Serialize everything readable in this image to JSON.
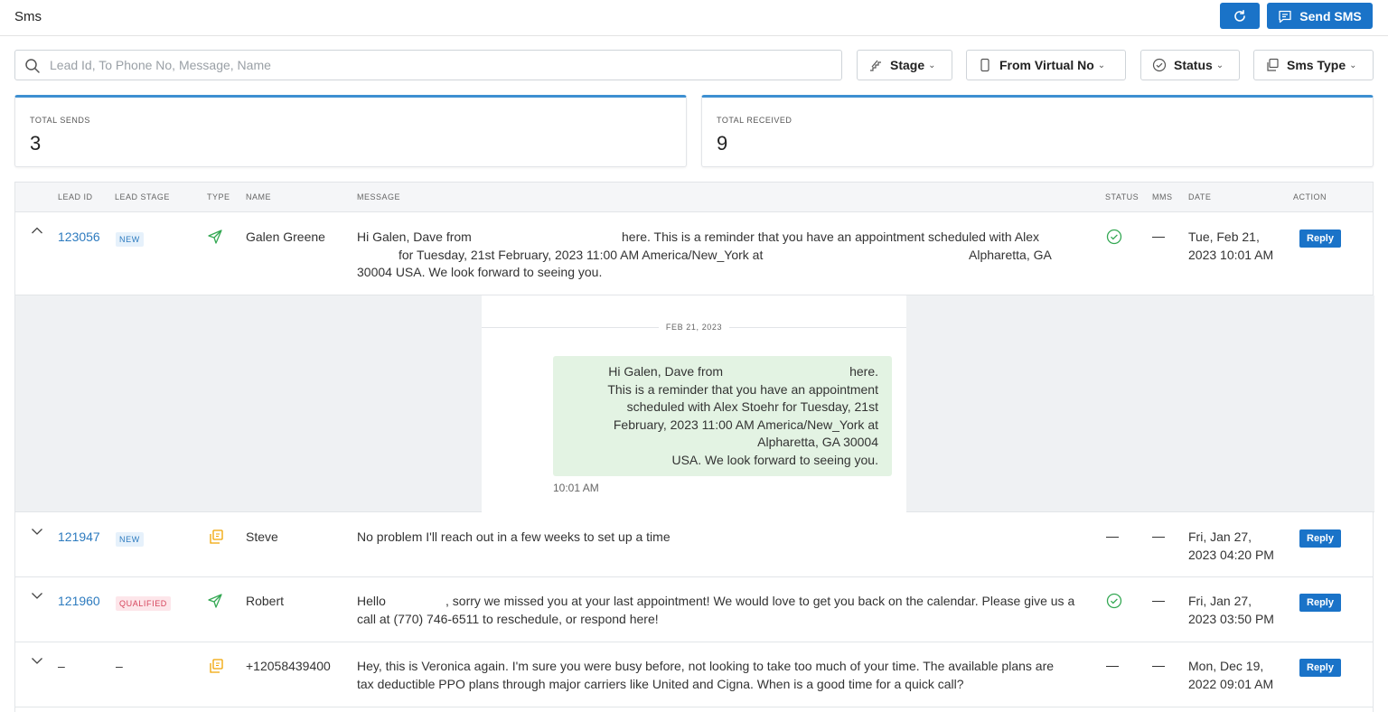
{
  "header": {
    "title": "Sms",
    "send_label": "Send SMS"
  },
  "search": {
    "placeholder": "Lead Id, To Phone No, Message, Name",
    "value": ""
  },
  "filters": {
    "stage": "Stage",
    "from_virtual_no": "From Virtual No",
    "status": "Status",
    "sms_type": "Sms Type"
  },
  "stats": {
    "sends_label": "TOTAL SENDS",
    "sends_value": "3",
    "received_label": "TOTAL RECEIVED",
    "received_value": "9"
  },
  "table": {
    "headers": {
      "lead_id": "LEAD ID",
      "lead_stage": "LEAD STAGE",
      "type": "TYPE",
      "name": "NAME",
      "message": "MESSAGE",
      "status": "STATUS",
      "mms": "MMS",
      "date": "DATE",
      "action": "ACTION"
    },
    "rows": [
      {
        "lead_id": "123056",
        "stage": "NEW",
        "type": "sent",
        "name": "Galen Greene",
        "message_l1a": "Hi Galen, Dave from",
        "message_l1b": "here. This is a reminder that you have an appointment scheduled with Alex",
        "message_l2a": "for Tuesday, 21st February, 2023 11:00 AM America/New_York at",
        "message_l2b": "Alpharetta, GA",
        "message_l3": "30004 USA. We look forward to seeing you.",
        "status": "delivered",
        "mms": "—",
        "date_l1": "Tue, Feb 21,",
        "date_l2": "2023 10:01 AM",
        "action": "Reply",
        "expanded": true
      },
      {
        "lead_id": "121947",
        "stage": "NEW",
        "type": "received",
        "name": "Steve",
        "message_l1": "No problem I'll reach out in a few weeks to set up a time",
        "status": "—",
        "mms": "—",
        "date_l1": "Fri, Jan 27,",
        "date_l2": "2023 04:20 PM",
        "action": "Reply"
      },
      {
        "lead_id": "121960",
        "stage": "QUALIFIED",
        "type": "sent",
        "name": "Robert",
        "message_l1a": "Hello",
        "message_l1b": ", sorry we missed you at your last appointment! We would love to get you back on the calendar. Please give us a",
        "message_l2": "call at (770) 746-6511 to reschedule, or respond here!",
        "status": "delivered",
        "mms": "—",
        "date_l1": "Fri, Jan 27,",
        "date_l2": "2023 03:50 PM",
        "action": "Reply"
      },
      {
        "lead_id": "–",
        "stage": "–",
        "type": "received",
        "name": "+12058439400",
        "message_l1": "Hey, this is Veronica again. I'm sure you were busy before, not looking to take too much of your time. The available plans are",
        "message_l2": "tax deductible PPO plans through major carriers like United and Cigna. When is a good time for a quick call?",
        "status": "—",
        "mms": "—",
        "date_l1": "Mon, Dec 19,",
        "date_l2": "2022 09:01 AM",
        "action": "Reply"
      }
    ]
  },
  "conversation": {
    "date": "FEB 21, 2023",
    "lines": [
      "Hi Galen, Dave from                                    here.",
      "This is a reminder that you have an appointment",
      "scheduled with Alex Stoehr for Tuesday, 21st",
      "February, 2023 11:00 AM America/New_York at",
      "Alpharetta, GA 30004",
      "USA. We look forward to seeing you."
    ],
    "time": "10:01 AM"
  },
  "colors": {
    "primary": "#1a73c8",
    "link": "#2d7bbf",
    "success": "#34a853",
    "sms_type_received": "#f0a500",
    "bubble_bg": "#e3f3e3",
    "card_accent": "#3d8fd1"
  }
}
